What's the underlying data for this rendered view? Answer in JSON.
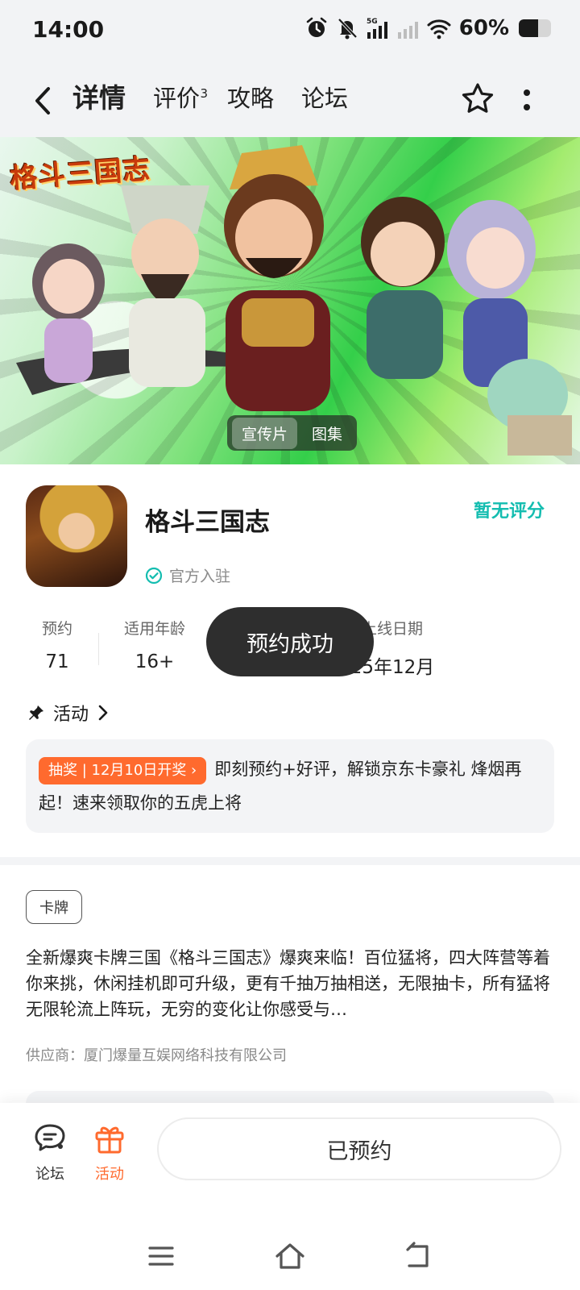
{
  "status_bar": {
    "time": "14:00",
    "network": "5G",
    "battery_percent": "60%",
    "battery_level": 0.6,
    "icons": [
      "alarm-icon",
      "mute-icon",
      "signal-icon",
      "signal-weak-icon",
      "wifi-icon",
      "battery-icon"
    ]
  },
  "header": {
    "tabs": [
      {
        "label": "详情",
        "active": true
      },
      {
        "label": "评价",
        "badge": "3"
      },
      {
        "label": "攻略"
      },
      {
        "label": "论坛"
      }
    ]
  },
  "banner": {
    "logo_text": "格斗三国志",
    "media_tabs": [
      "宣传片",
      "图集"
    ],
    "active_media_tab": "宣传片"
  },
  "app": {
    "name": "格斗三国志",
    "official": "官方入驻",
    "rating": "暂无评分"
  },
  "stats": [
    {
      "label": "预约",
      "value": "71"
    },
    {
      "label": "适用年龄",
      "value": "16+"
    },
    {
      "label": "上线日期",
      "value": "25年12月"
    }
  ],
  "toast": "预约成功",
  "activity": {
    "title": "活动",
    "badge": "抽奖 | 12月10日开奖 ›",
    "text": "即刻预约+好评，解锁京东卡豪礼 烽烟再起！速来领取你的五虎上将"
  },
  "tag": "卡牌",
  "description": "全新爆爽卡牌三国《格斗三国志》爆爽来临！百位猛将，四大阵营等着你来挑，休闲挂机即可升级，更有千抽万抽相送，无限抽卡，所有猛将无限轮流上阵玩，无穷的变化让你感受与…",
  "supplier": "供应商：厦门爆量互娱网络科技有限公司",
  "bottom": {
    "forum_label": "论坛",
    "activity_label": "活动",
    "reserve_label": "已预约",
    "accent": "#ff6a2e"
  },
  "colors": {
    "teal": "#14bdb0",
    "tab_underline": "#12d1c1"
  }
}
